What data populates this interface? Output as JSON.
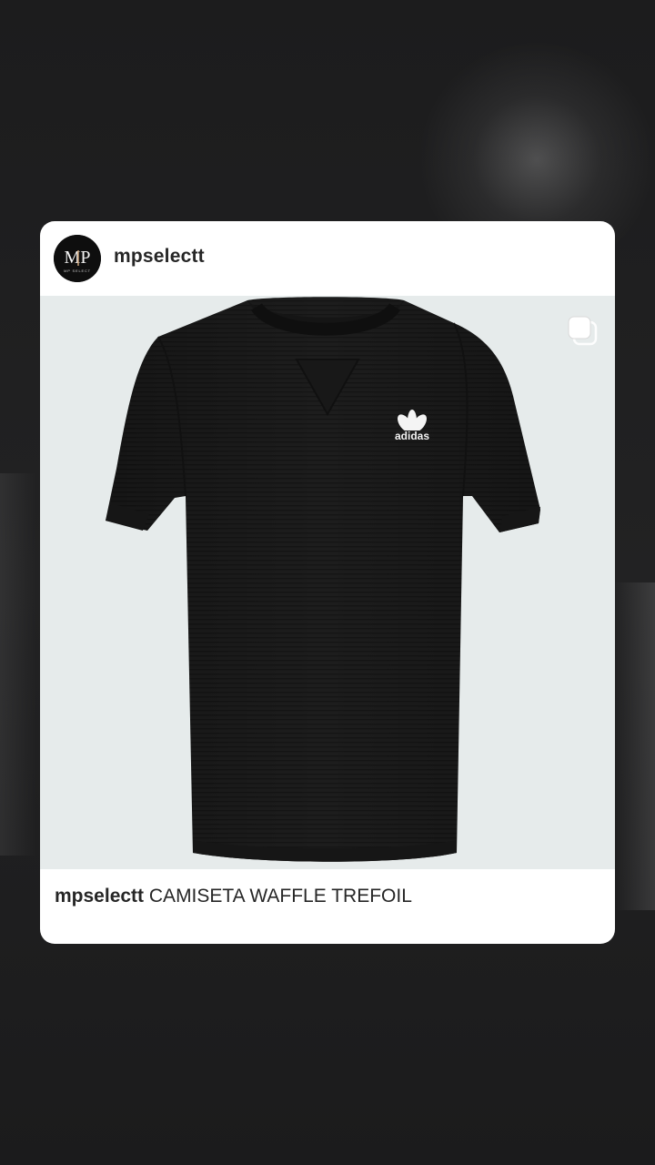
{
  "post": {
    "username": "mpselectt",
    "avatar_initials": "MP",
    "avatar_subtext": "MP SELECT",
    "caption_user": "mpselectt",
    "caption_text": "CAMISETA WAFFLE TREFOIL",
    "logo_text": "adidas",
    "carousel_icon": "multiple-images-icon",
    "image_background": "#e6ebeb",
    "shirt_color": "#1c1c1c"
  }
}
